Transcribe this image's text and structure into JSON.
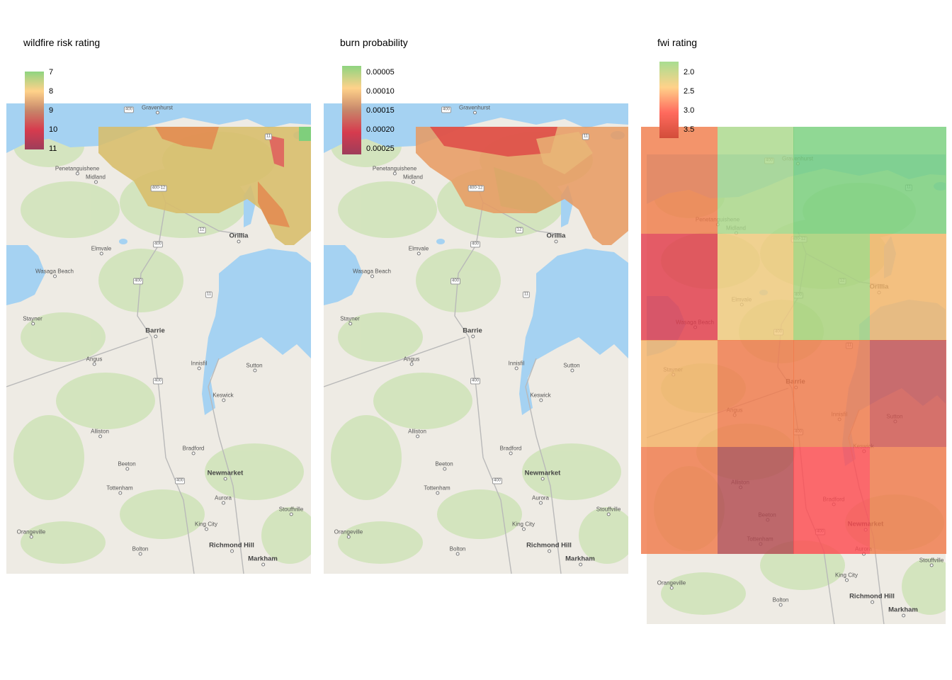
{
  "panels": [
    {
      "title": "wildfire risk rating",
      "legend": {
        "labels": [
          "7",
          "8",
          "9",
          "10",
          "11"
        ],
        "gradient": [
          "#8fd480",
          "#ffd28a",
          "#c7866a",
          "#d63b4e",
          "#9e3d5a"
        ]
      }
    },
    {
      "title": "burn probability",
      "legend": {
        "labels": [
          "0.00005",
          "0.00010",
          "0.00015",
          "0.00020",
          "0.00025"
        ],
        "gradient": [
          "#8fd480",
          "#ffd28a",
          "#c7866a",
          "#d63b4e",
          "#9e3d5a"
        ]
      }
    },
    {
      "title": "fwi rating",
      "legend": {
        "labels": [
          "2.0",
          "2.5",
          "3.0",
          "3.5"
        ],
        "gradient": [
          "#a8dd90",
          "#ffd28a",
          "#ff6a5e",
          "#d24d3a"
        ]
      },
      "grid": [
        [
          "#f07c4a",
          "#aad88a",
          "#78d07c",
          "#78d07c"
        ],
        [
          "#e23a4a",
          "#f0ca7e",
          "#a8d37c",
          "#f4b66a"
        ],
        [
          "#f4b268",
          "#f07a4c",
          "#f07a4c",
          "#d05650"
        ],
        [
          "#f07a4c",
          "#b24a50",
          "#fe4c52",
          "#f07a4c"
        ]
      ]
    }
  ],
  "places": [
    {
      "name": "Gravenhurst"
    },
    {
      "name": "Penetanguishene"
    },
    {
      "name": "Midland"
    },
    {
      "name": "Orillia",
      "big": true
    },
    {
      "name": "Elmvale"
    },
    {
      "name": "Wasaga Beach"
    },
    {
      "name": "Stayner"
    },
    {
      "name": "Barrie",
      "big": true
    },
    {
      "name": "Angus"
    },
    {
      "name": "Innisfil"
    },
    {
      "name": "Sutton"
    },
    {
      "name": "Keswick"
    },
    {
      "name": "Alliston"
    },
    {
      "name": "Bradford"
    },
    {
      "name": "Beeton"
    },
    {
      "name": "Newmarket",
      "big": true
    },
    {
      "name": "Tottenham"
    },
    {
      "name": "Aurora"
    },
    {
      "name": "Stouffville"
    },
    {
      "name": "Orangeville"
    },
    {
      "name": "King City"
    },
    {
      "name": "Bolton"
    },
    {
      "name": "Richmond Hill",
      "big": true
    },
    {
      "name": "Markham",
      "big": true
    }
  ],
  "highways": [
    "400",
    "400",
    "12",
    "400",
    "400",
    "11",
    "400",
    "400",
    "11",
    "400-12"
  ],
  "colors": {
    "water": "#a5d2f2",
    "land": "#eeebe4",
    "green": "#cfe3b8"
  }
}
